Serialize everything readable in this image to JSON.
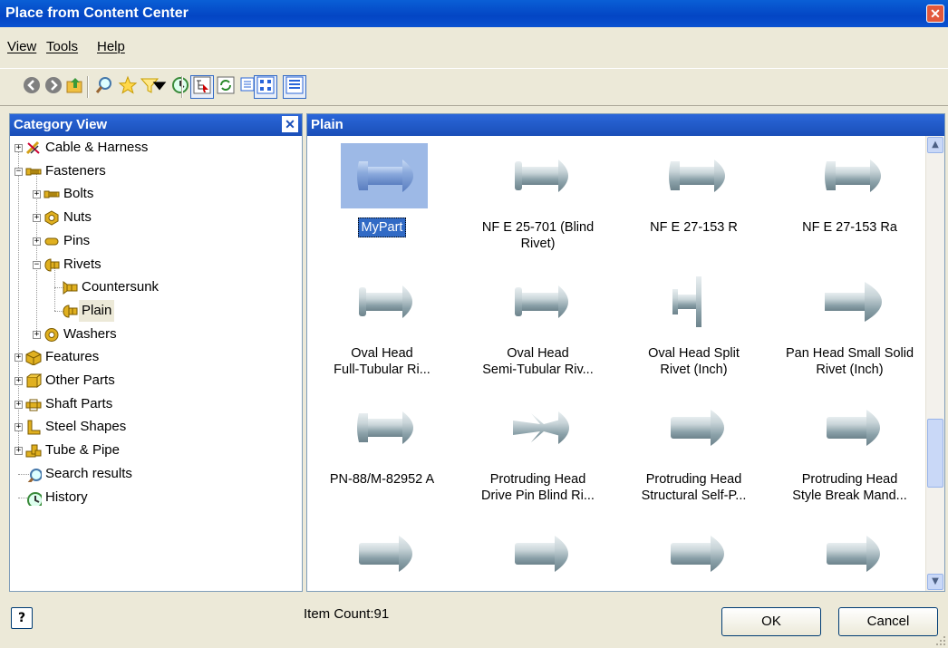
{
  "window": {
    "title": "Place from Content Center",
    "close_glyph": "✕"
  },
  "menu": [
    {
      "label": "View"
    },
    {
      "label": "Tools"
    },
    {
      "label": "Help"
    }
  ],
  "toolbar": [
    {
      "icon": "back-icon"
    },
    {
      "icon": "forward-icon"
    },
    {
      "icon": "up-folder-icon"
    },
    {
      "icon": "search-icon"
    },
    {
      "icon": "favorites-star-icon"
    },
    {
      "icon": "filter-icon"
    },
    {
      "icon": "filter-dropdown-icon"
    },
    {
      "icon": "history-icon"
    },
    {
      "icon": "tree-view-icon"
    },
    {
      "icon": "refresh-icon"
    },
    {
      "icon": "view-options-icon"
    },
    {
      "icon": "thumbnail-view-icon"
    },
    {
      "icon": "list-view-icon"
    }
  ],
  "category_panel": {
    "title": "Category View",
    "close_glyph": "✕",
    "tree": [
      {
        "label": "Cable & Harness",
        "icon": "cable-harness-icon",
        "expander": "+"
      },
      {
        "label": "Fasteners",
        "icon": "fasteners-icon",
        "expander": "−"
      },
      {
        "label": "Bolts",
        "icon": "bolt-icon",
        "expander": "+"
      },
      {
        "label": "Nuts",
        "icon": "nut-icon",
        "expander": "+"
      },
      {
        "label": "Pins",
        "icon": "pin-icon",
        "expander": "+"
      },
      {
        "label": "Rivets",
        "icon": "rivet-icon",
        "expander": "−"
      },
      {
        "label": "Countersunk",
        "icon": "countersunk-rivet-icon"
      },
      {
        "label": "Plain",
        "icon": "plain-rivet-icon",
        "selected": true
      },
      {
        "label": "Washers",
        "icon": "washer-icon",
        "expander": "+"
      },
      {
        "label": "Features",
        "icon": "features-icon",
        "expander": "+"
      },
      {
        "label": "Other Parts",
        "icon": "other-parts-icon",
        "expander": "+"
      },
      {
        "label": "Shaft Parts",
        "icon": "shaft-parts-icon",
        "expander": "+"
      },
      {
        "label": "Steel Shapes",
        "icon": "steel-shapes-icon",
        "expander": "+"
      },
      {
        "label": "Tube & Pipe",
        "icon": "tube-pipe-icon",
        "expander": "+"
      },
      {
        "label": "Search results",
        "icon": "search-icon"
      },
      {
        "label": "History",
        "icon": "history-icon"
      }
    ]
  },
  "content_panel": {
    "title": "Plain",
    "items": [
      {
        "line1": "MyPart",
        "line2": "",
        "selected": true,
        "shape": "dome"
      },
      {
        "line1": "NF E 25-701 (Blind",
        "line2": "Rivet)",
        "shape": "flat"
      },
      {
        "line1": "NF E 27-153 R",
        "line2": "",
        "shape": "dome"
      },
      {
        "line1": "NF E 27-153 Ra",
        "line2": "",
        "shape": "dome"
      },
      {
        "line1": "Oval Head",
        "line2": "Full-Tubular Ri...",
        "shape": "flat"
      },
      {
        "line1": "Oval Head",
        "line2": "Semi-Tubular Riv...",
        "shape": "flat"
      },
      {
        "line1": "Oval Head Split",
        "line2": "Rivet (Inch)",
        "shape": "split"
      },
      {
        "line1": "Pan Head Small Solid",
        "line2": "Rivet (Inch)",
        "shape": "pan"
      },
      {
        "line1": "PN-88/M-82952 A",
        "line2": "",
        "shape": "dome"
      },
      {
        "line1": "Protruding Head",
        "line2": "Drive Pin Blind Ri...",
        "shape": "drive"
      },
      {
        "line1": "Protruding Head",
        "line2": "Structural Self-P...",
        "shape": "long"
      },
      {
        "line1": "Protruding Head",
        "line2": "Style Break Mand...",
        "shape": "long"
      },
      {
        "line1": "",
        "line2": "",
        "shape": "long"
      },
      {
        "line1": "",
        "line2": "",
        "shape": "long"
      },
      {
        "line1": "",
        "line2": "",
        "shape": "long"
      },
      {
        "line1": "",
        "line2": "",
        "shape": "long"
      }
    ]
  },
  "status": {
    "help_glyph": "?",
    "item_count": "Item Count:91"
  },
  "buttons": {
    "ok": "OK",
    "cancel": "Cancel"
  },
  "colors": {
    "title_bar": "#0345c4",
    "panel_header": "#1a4fb8",
    "selection": "#316ac5",
    "face": "#ece9d8"
  }
}
